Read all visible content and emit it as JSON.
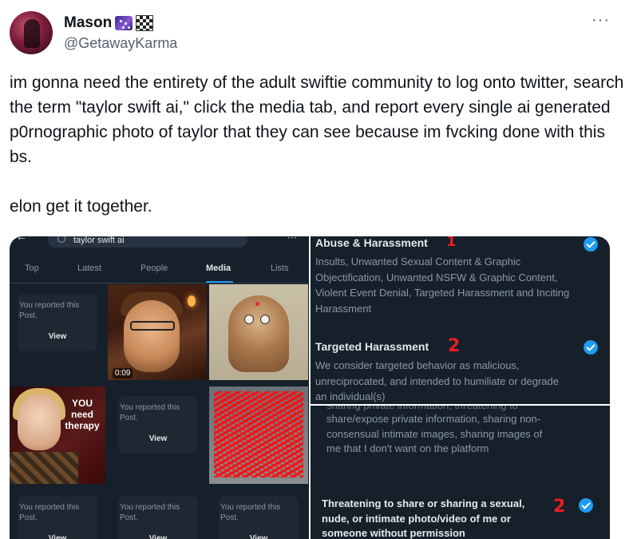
{
  "post": {
    "author": {
      "name": "Mason",
      "handle": "@GetawayKarma",
      "emoji_icons": [
        "galaxy-emoji-icon",
        "checkered-flag-icon"
      ]
    },
    "more_label": "···",
    "text": "im gonna need the entirety of the adult swiftie community to log onto twitter, search the term \"taylor swift ai,\" click the media tab, and report every single ai generated p0rnographic photo of taylor that they can see because im fvcking done with this bs.\n\nelon get it together."
  },
  "screenshot_left": {
    "search_value": "taylor swift ai",
    "more_label": "···",
    "tabs": [
      "Top",
      "Latest",
      "People",
      "Media",
      "Lists"
    ],
    "active_tab": "Media",
    "reported_text": "You reported this Post.",
    "view_label": "View",
    "video_duration": "0:09",
    "meme_caption_line1": "YOU",
    "meme_caption_line2": "need",
    "meme_caption_line3": "therapy"
  },
  "screenshot_right_top": {
    "section1_title": "Abuse & Harassment",
    "section1_number": "1",
    "section1_body": "Insults, Unwanted Sexual Content & Graphic Objectification, Unwanted NSFW & Graphic Content, Violent Event Denial, Targeted Harassment and Inciting Harassment",
    "section2_title": "Targeted Harassment",
    "section2_number": "2",
    "section2_body": "We consider targeted behavior as malicious, unreciprocated, and intended to humiliate or degrade an individual(s)"
  },
  "screenshot_right_bottom": {
    "partial_top": "sharing private information, threatening to",
    "body": "share/expose private information, sharing non-consensual intimate images, sharing images of me that I don't want on the platform",
    "option_title": "Threatening to share or sharing a sexual, nude, or intimate photo/video of me or someone without permission",
    "option_number": "2"
  },
  "colors": {
    "accent": "#1d9bf0",
    "annotation_red": "#ee1d1d",
    "dark_bg": "#15202b"
  }
}
